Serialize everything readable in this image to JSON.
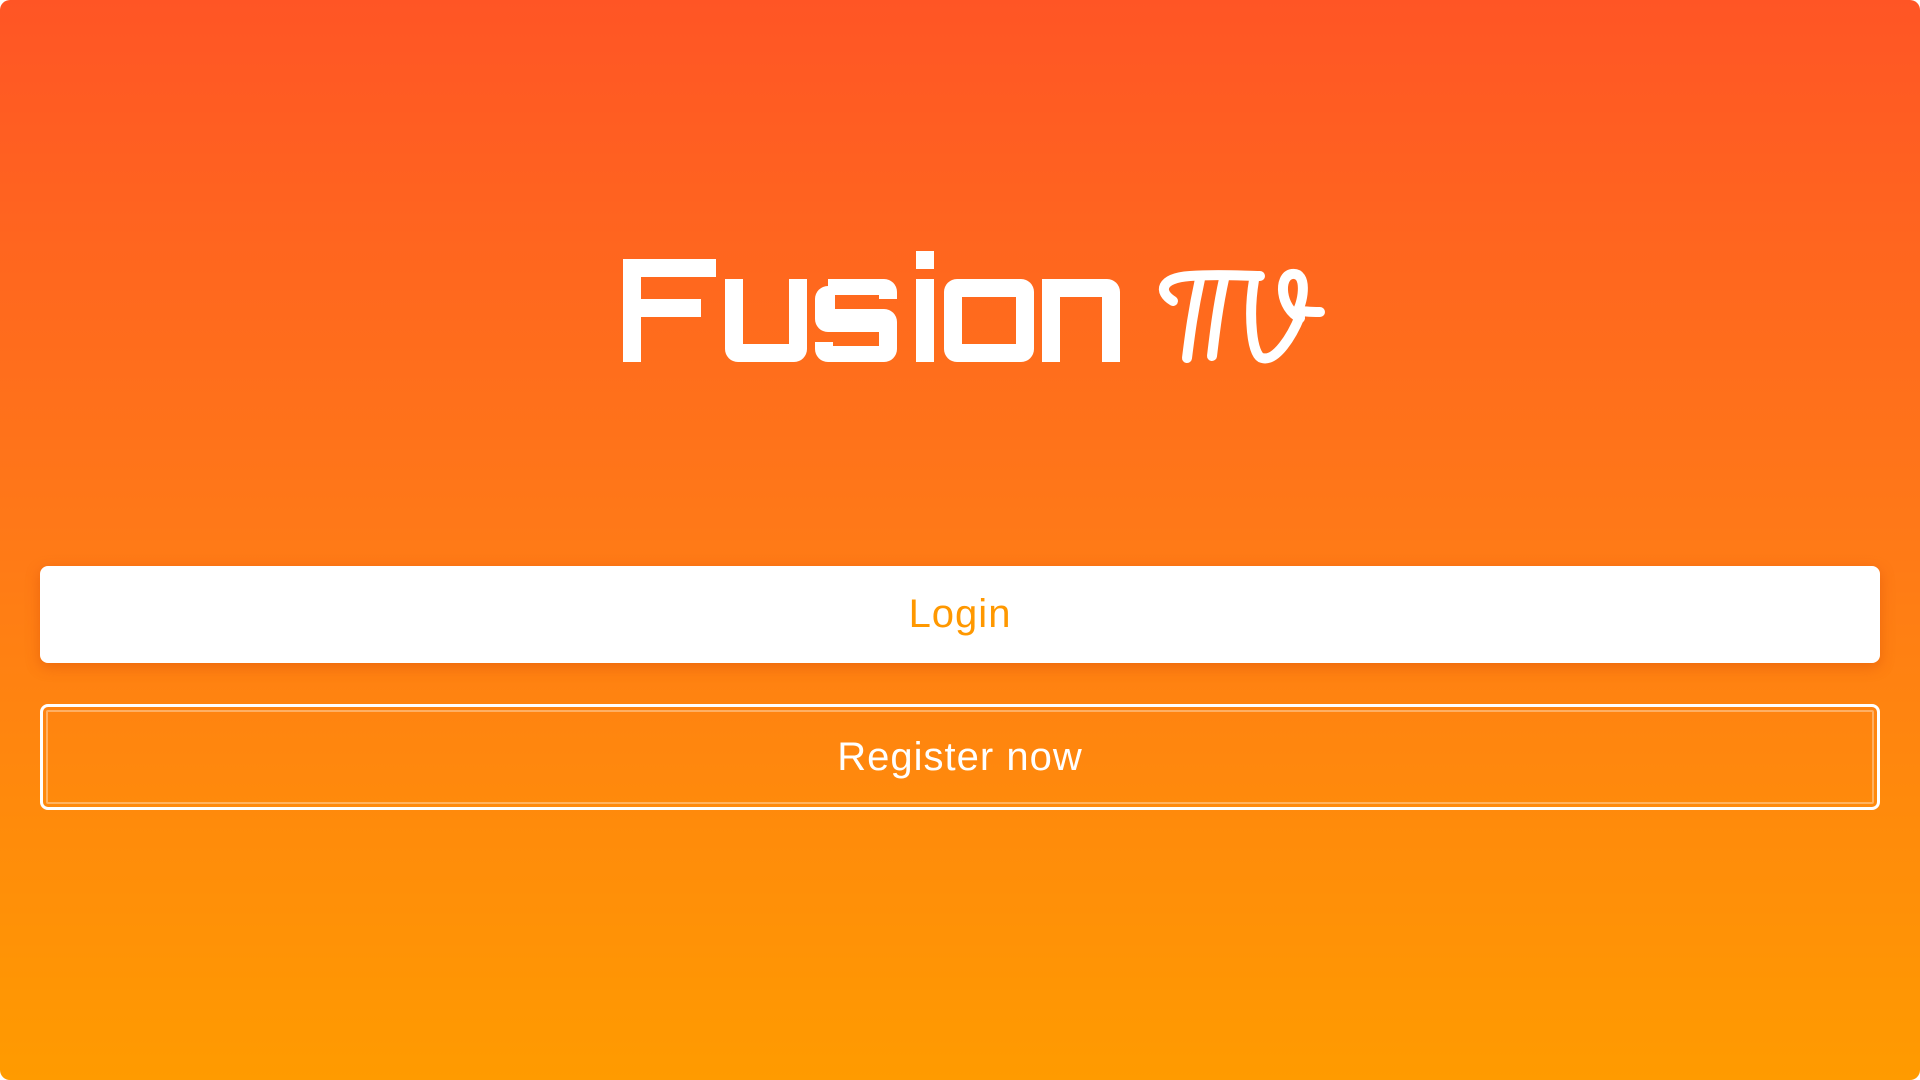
{
  "app": {
    "brand_name": "Fusion TV",
    "brand_part_main": "Fusion",
    "brand_part_script": "TV"
  },
  "actions": {
    "login_label": "Login",
    "register_label": "Register now"
  },
  "colors": {
    "gradient_top": "#ff5525",
    "gradient_bottom": "#ff9b00",
    "login_text": "#ff9800",
    "register_text": "#ffffff",
    "logo": "#ffffff"
  }
}
